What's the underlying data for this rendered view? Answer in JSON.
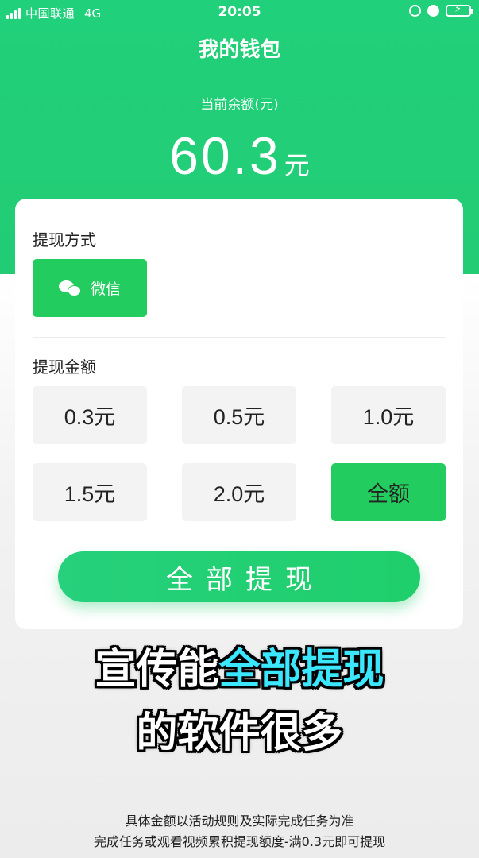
{
  "status_bar": {
    "carrier": "中国联通",
    "network": "4G",
    "time": "20:05"
  },
  "header": {
    "title": "我的钱包",
    "balance_label": "当前余额(元)",
    "balance_amount": "60.3",
    "balance_unit": "元"
  },
  "card": {
    "method_label": "提现方式",
    "method_option": "微信",
    "amount_label": "提现金额",
    "amounts": [
      "0.3元",
      "0.5元",
      "1.0元",
      "1.5元",
      "2.0元",
      "全额"
    ],
    "selected_amount": "全额",
    "withdraw_button": "全部提现"
  },
  "captions": {
    "line1_prefix": "宣传能",
    "line1_highlight": "全部提现",
    "line2": "的软件很多"
  },
  "footnotes": [
    "具体金额以活动规则及实际完成任务为准",
    "完成任务或观看视频累积提现额度-满0.3元即可提现"
  ],
  "colors": {
    "brand_green": "#22cc5e",
    "header_green": "#21d07a",
    "caption_highlight": "#3be6ff"
  }
}
